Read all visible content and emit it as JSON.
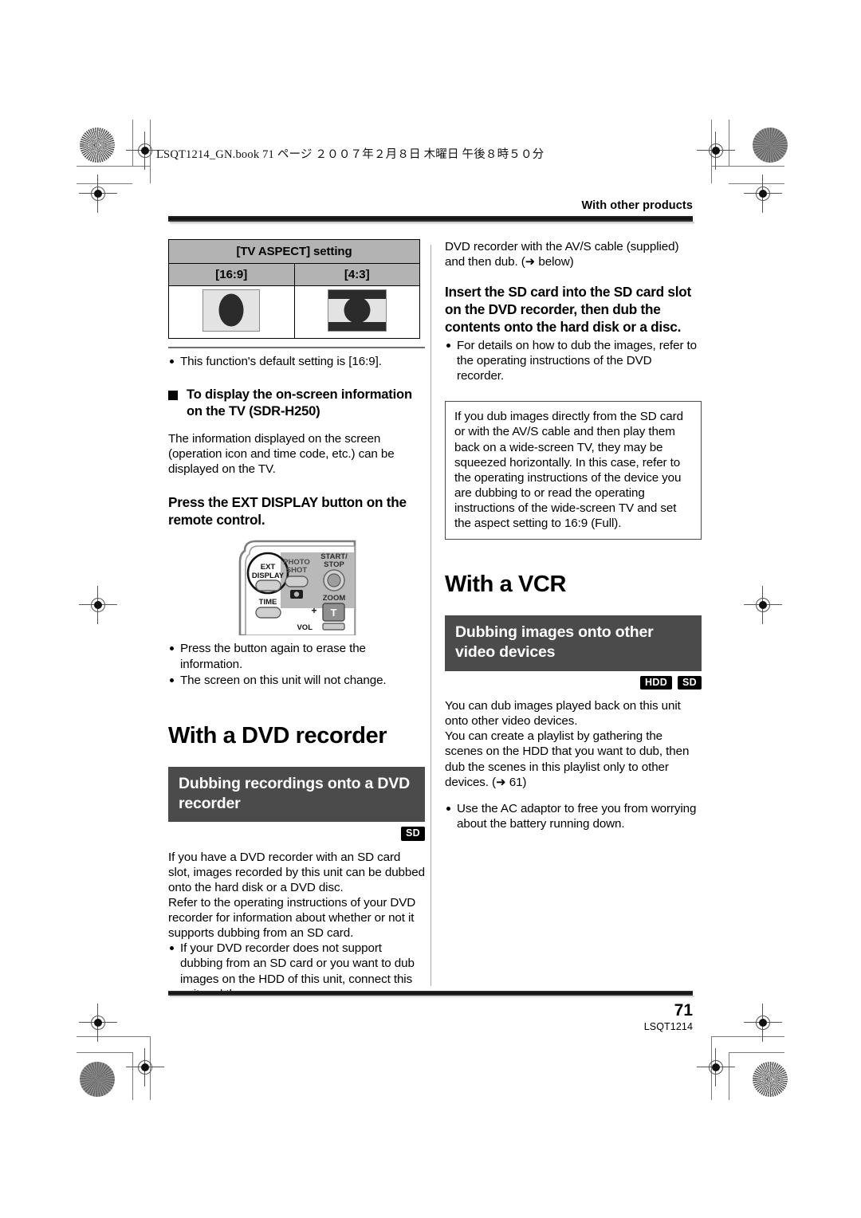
{
  "page": {
    "book_line": "LSQT1214_GN.book  71 ページ  ２００７年２月８日  木曜日  午後８時５０分",
    "running_head": "With other products",
    "page_number": "71",
    "page_code": "LSQT1214"
  },
  "left_column": {
    "aspect_table": {
      "title": "[TV ASPECT] setting",
      "columns": [
        "[16:9]",
        "[4:3]"
      ]
    },
    "default_note": "This function's default setting is [16:9].",
    "onscreen_heading": "To display the on-screen information on the TV (SDR-H250)",
    "onscreen_body": "The information displayed on the screen (operation icon and time code, etc.) can be displayed on the TV.",
    "onscreen_step": "Press the EXT DISPLAY button on the remote control.",
    "remote_labels": {
      "ext_display": "EXT DISPLAY",
      "photo_shot": "PHOTO SHOT",
      "start_stop": "START/ STOP",
      "time": "TIME",
      "zoom": "ZOOM",
      "vol": "VOL",
      "plus": "+",
      "tele": "T"
    },
    "remote_bullets": [
      "Press the button again to erase the information.",
      "The screen on this unit will not change."
    ],
    "dvd_chapter_title": "With a DVD recorder",
    "dvd_banner": "Dubbing recordings onto a DVD recorder",
    "dvd_badges": [
      "SD"
    ],
    "dvd_body_1": "If you have a DVD recorder with an SD card slot, images recorded by this unit can be dubbed onto the hard disk or a DVD disc.",
    "dvd_body_2": "Refer to the operating instructions of your DVD recorder for information about whether or not it supports dubbing from an SD card.",
    "dvd_bullets": [
      "If your DVD recorder does not support dubbing from an SD card or you want to dub images on the HDD of this unit, connect this unit and the"
    ]
  },
  "right_column": {
    "continued_text": "DVD recorder with the AV/S cable (supplied) and then dub. (➜ below)",
    "insert_step": "Insert the SD card into the SD card slot on the DVD recorder, then dub the contents onto the hard disk or a disc.",
    "insert_bullets": [
      "For details on how to dub the images, refer to the operating instructions of the DVD recorder."
    ],
    "note_box": "If you dub images directly from the SD card or with the AV/S cable and then play them back on a wide-screen TV, they may be squeezed horizontally. In this case, refer to the operating instructions of the device you are dubbing to or read the operating instructions of the wide-screen TV and set the aspect setting to 16:9 (Full).",
    "vcr_chapter_title": "With a VCR",
    "vcr_banner": "Dubbing images onto other video devices",
    "vcr_badges": [
      "HDD",
      "SD"
    ],
    "vcr_body_1": "You can dub images played back on this unit onto other video devices.",
    "vcr_body_2": "You can create a playlist by gathering the scenes on the HDD that you want to dub, then dub the scenes in this playlist only to other devices. (➜ 61)",
    "vcr_bullets": [
      "Use the AC adaptor to free you from worrying about the battery running down."
    ]
  },
  "colors": {
    "banner_bg": "#4b4b4b",
    "table_header_bg": "#b3b3b3",
    "badge_bg": "#000000",
    "rule": "#0d0d0d"
  }
}
